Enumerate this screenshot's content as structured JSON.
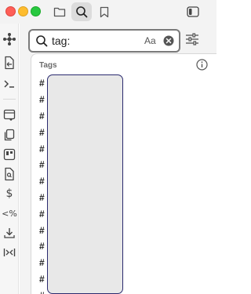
{
  "window": {
    "title_bar_buttons": [
      "close",
      "minimize",
      "zoom"
    ],
    "colors": {
      "close": "#fe5f57",
      "minimize": "#febc2e",
      "zoom": "#28c840"
    }
  },
  "toolbar": {
    "tabs": [
      {
        "icon": "folder-icon",
        "active": false
      },
      {
        "icon": "search-icon",
        "active": true
      },
      {
        "icon": "bookmark-icon",
        "active": false
      }
    ],
    "right_icon": "sidebar-toggle-icon"
  },
  "ribbon": {
    "icons": [
      "graph-icon",
      "file-import-icon",
      "terminal-icon",
      "template-icon",
      "copy-icon",
      "kanban-icon",
      "file-search-icon",
      "dollar-icon",
      "percent-compare-icon",
      "download-icon",
      "split-icon"
    ]
  },
  "search": {
    "value": "tag:",
    "match_case_label": "Aa"
  },
  "suggestions": {
    "header": "Tags",
    "tags": [
      "#",
      "#",
      "#",
      "#",
      "#",
      "#",
      "#",
      "#",
      "#",
      "#",
      "#",
      "#",
      "#",
      "#"
    ]
  }
}
